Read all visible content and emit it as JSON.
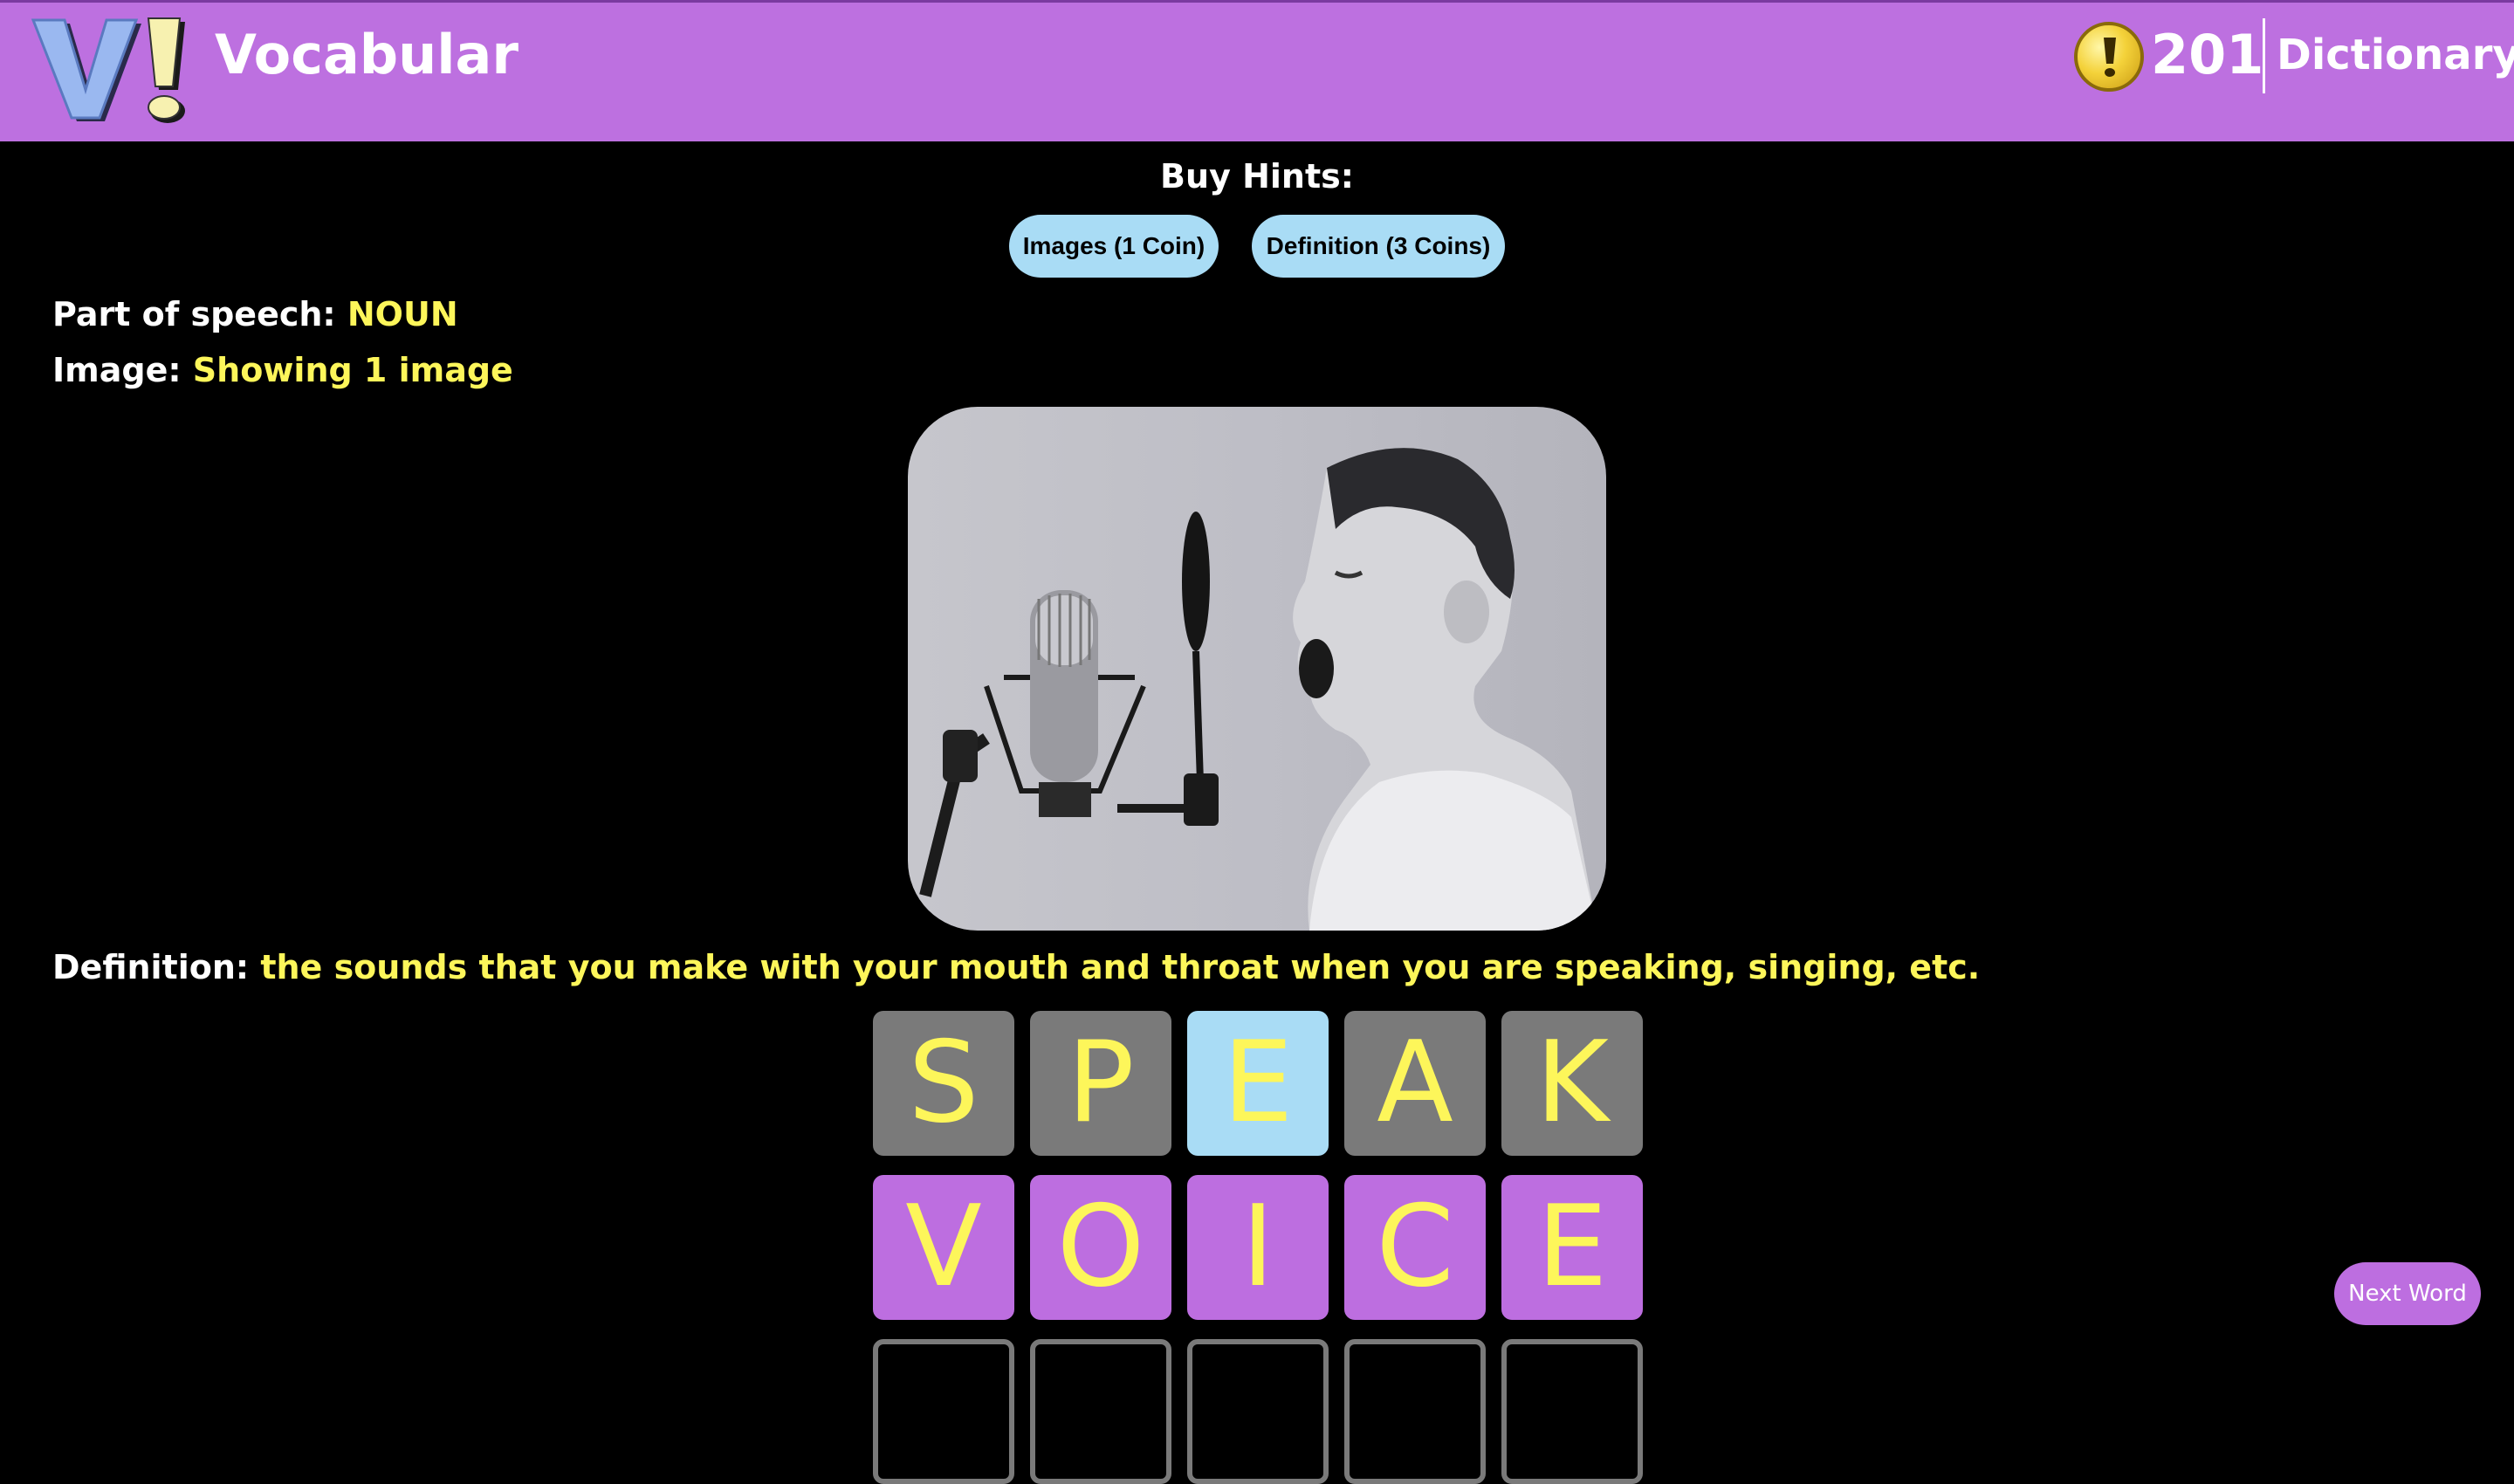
{
  "header": {
    "brand": "Vocabular",
    "coins": "201",
    "dictionary_link": "Dictionary"
  },
  "hints": {
    "title": "Buy Hints:",
    "images_button": "Images (1 Coin)",
    "definition_button": "Definition (3 Coins)"
  },
  "clues": {
    "pos_label": "Part of speech:",
    "pos_value": "NOUN",
    "image_label": "Image:",
    "image_value": "Showing 1 image",
    "definition_label": "Definition:",
    "definition_value": "the sounds that you make with your mouth and throat when you are speaking, singing, etc."
  },
  "board": {
    "rows": [
      {
        "letters": [
          "S",
          "P",
          "E",
          "A",
          "K"
        ],
        "states": [
          "gray",
          "gray",
          "blue",
          "gray",
          "gray"
        ]
      },
      {
        "letters": [
          "V",
          "O",
          "I",
          "C",
          "E"
        ],
        "states": [
          "purple",
          "purple",
          "purple",
          "purple",
          "purple"
        ]
      },
      {
        "letters": [
          "",
          "",
          "",
          "",
          ""
        ],
        "states": [
          "empty",
          "empty",
          "empty",
          "empty",
          "empty"
        ]
      }
    ]
  },
  "colors": {
    "header_bg": "#bd70e0",
    "highlight_text": "#fdf65a",
    "hint_button_bg": "#a9dcf5",
    "tile_absent": "#7a7a7a",
    "tile_present": "#a9dcf5",
    "tile_correct": "#bd6ee0"
  },
  "next_button": "Next Word"
}
